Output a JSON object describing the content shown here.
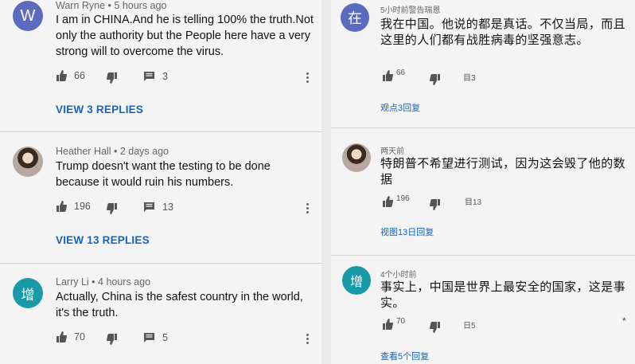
{
  "left": {
    "comments": [
      {
        "avatar_letter": "W",
        "avatar_color": "#5c6bc0",
        "author": "Warn Ryne",
        "time": "5 hours ago",
        "text": "I am in CHINA.And he is telling 100% the truth.Not only the authority but the People here have a very strong will to overcome the virus.",
        "likes": "66",
        "comment_count": "3",
        "replies_label": "VIEW 3 REPLIES"
      },
      {
        "avatar_letter": "",
        "avatar_color": "#9a8c86",
        "author": "Heather Hall",
        "time": "2 days ago",
        "text": "Trump doesn't want the testing to be done because it would ruin his numbers.",
        "likes": "196",
        "comment_count": "13",
        "replies_label": "VIEW 13 REPLIES"
      },
      {
        "avatar_letter": "增",
        "avatar_color": "#1a9aa8",
        "author": "Larry Li",
        "time": "4 hours ago",
        "text": "Actually, China is the safest country in the world, it's the truth.",
        "likes": "70",
        "comment_count": "5",
        "replies_label": ""
      }
    ]
  },
  "right": {
    "comments": [
      {
        "avatar_letter": "在",
        "avatar_color": "#5c6bc0",
        "meta": "5小时前警告瑞恩",
        "text": "我在中国。他说的都是真话。不仅当局，而且这里的人们都有战胜病毒的坚强意志。",
        "likes": "66",
        "comment_count": "目3",
        "replies_label": "观点3回复"
      },
      {
        "avatar_letter": "",
        "avatar_color": "#9a8c86",
        "meta": "两天前",
        "text": "特朗普不希望进行测试，因为这会毁了他的数据",
        "likes": "196",
        "comment_count": "目13",
        "replies_label": "视图13日回复"
      },
      {
        "avatar_letter": "增",
        "avatar_color": "#1a9aa8",
        "meta": "4个小时前",
        "text": "事实上，中国是世界上最安全的国家，这是事实。",
        "likes": "70",
        "comment_count": "日5",
        "replies_label": "查看5个回复",
        "star": "*"
      }
    ]
  },
  "colors": {
    "link": "#1565c0",
    "background": "#f4f4f4",
    "divider": "#d2d2d2"
  },
  "icons": {
    "like": "thumbs-up-icon",
    "dislike": "thumbs-down-icon",
    "comment": "comment-icon",
    "more": "more-vert-icon"
  }
}
